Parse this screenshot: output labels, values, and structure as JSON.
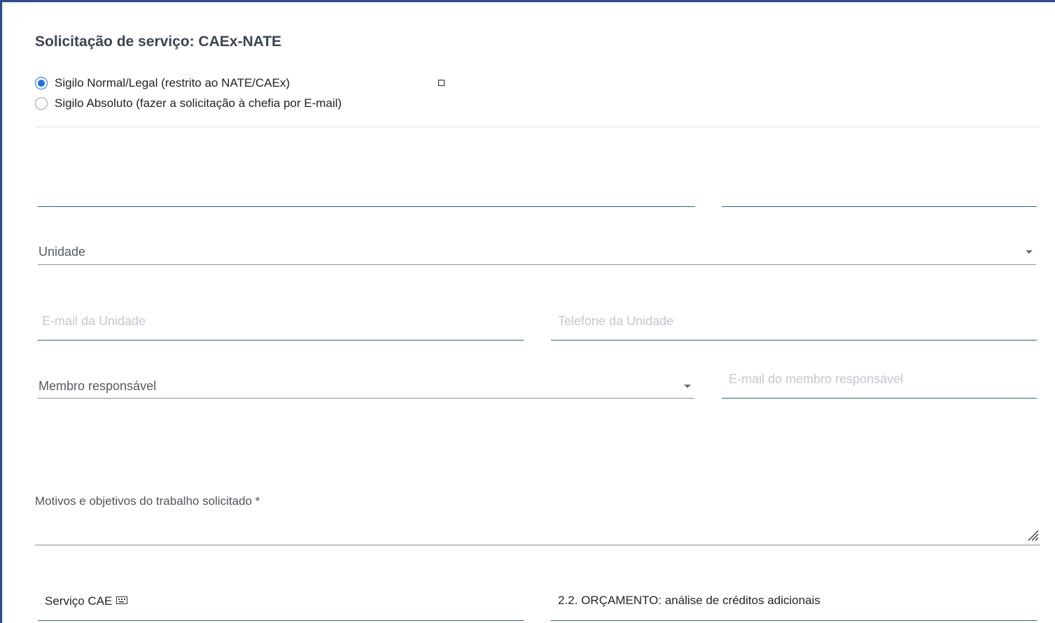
{
  "form": {
    "title": "Solicitação de serviço: CAEx-NATE",
    "sigilo_options": [
      {
        "label": "Sigilo Normal/Legal (restrito ao NATE/CAEx)",
        "selected": true
      },
      {
        "label": "Sigilo Absoluto (fazer a solicitação à chefia por E-mail)",
        "selected": false
      }
    ],
    "unidade": {
      "label": "Unidade"
    },
    "email_unidade": {
      "placeholder": "E-mail da Unidade"
    },
    "telefone_unidade": {
      "placeholder": "Telefone da Unidade"
    },
    "membro_responsavel": {
      "label": "Membro responsável"
    },
    "email_membro": {
      "placeholder": "E-mail do membro responsável"
    },
    "motivos": {
      "label": "Motivos e objetivos do trabalho solicitado *"
    },
    "servico_cae": {
      "label": "Serviço CAE",
      "icon": "keyboard-icon"
    },
    "servico_value": "2.2. ORÇAMENTO: análise de créditos adicionais"
  },
  "colors": {
    "accent": "#1a73e8",
    "underline_teal": "#1f6d78",
    "frame_border": "#2c4d8a"
  }
}
